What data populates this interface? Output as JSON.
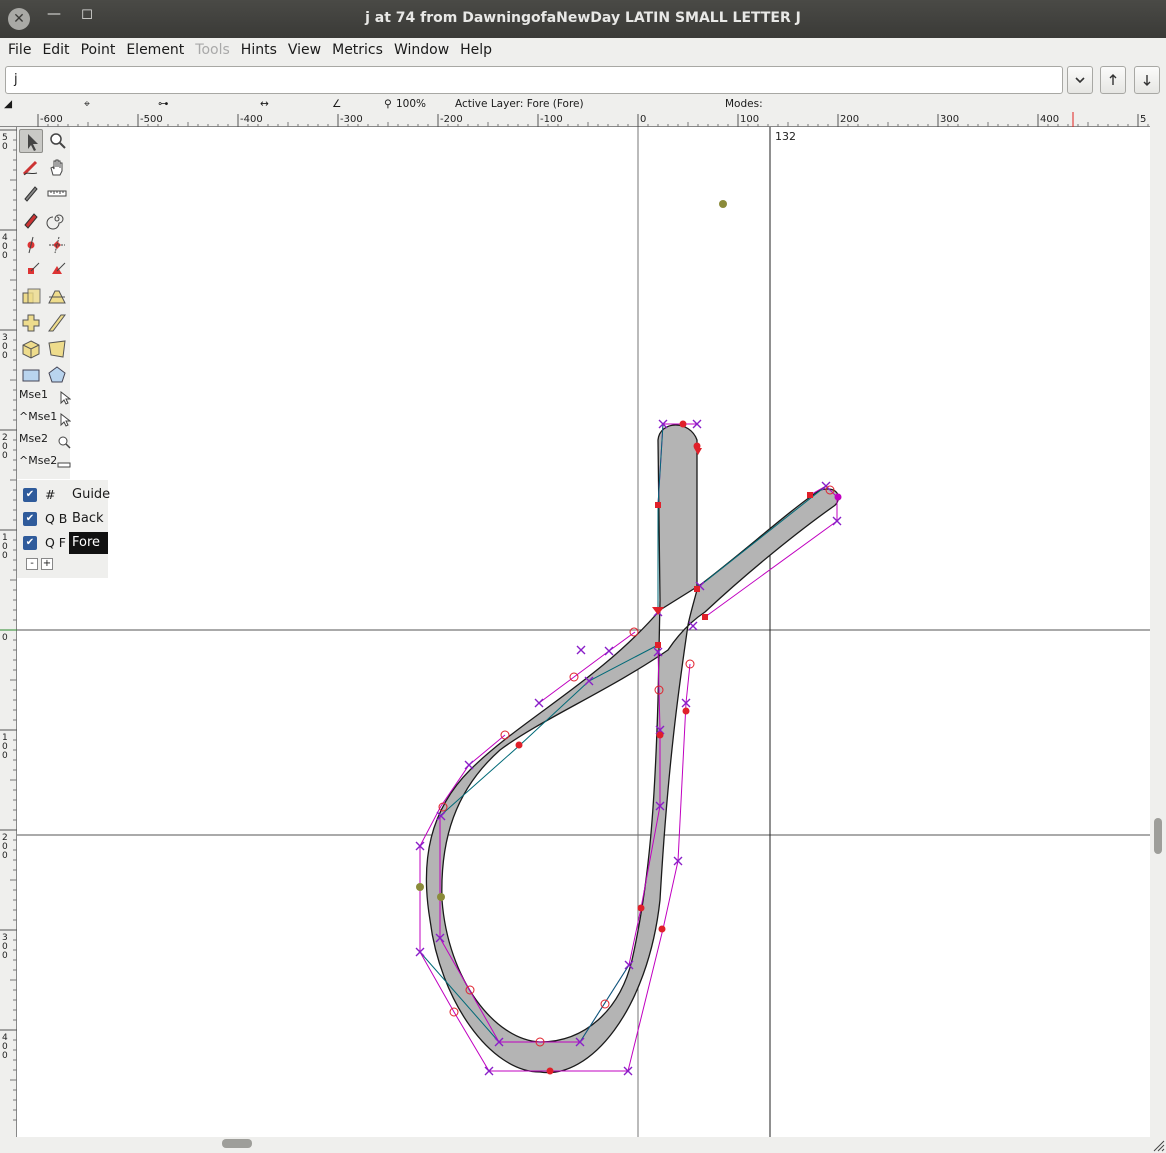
{
  "window": {
    "title": "j at 74 from DawningofaNewDay LATIN SMALL LETTER J",
    "close_glyph": "✕",
    "minimize_glyph": "—",
    "maximize_glyph": "☐"
  },
  "menu": [
    {
      "label": "File",
      "enabled": true
    },
    {
      "label": "Edit",
      "enabled": true
    },
    {
      "label": "Point",
      "enabled": true
    },
    {
      "label": "Element",
      "enabled": true
    },
    {
      "label": "Tools",
      "enabled": false
    },
    {
      "label": "Hints",
      "enabled": true
    },
    {
      "label": "View",
      "enabled": true
    },
    {
      "label": "Metrics",
      "enabled": true
    },
    {
      "label": "Window",
      "enabled": true
    },
    {
      "label": "Help",
      "enabled": true
    }
  ],
  "glyph_field": {
    "value": "j"
  },
  "info_bar": {
    "zoom": "100%",
    "active_layer": "Active Layer: Fore (Fore)",
    "modes": "Modes:"
  },
  "rulers": {
    "horizontal_ticks": [
      "-600",
      "-500",
      "-400",
      "-300",
      "-200",
      "-100",
      "0",
      "100",
      "200",
      "300",
      "400",
      "5"
    ],
    "vertical_ticks": [
      "5 0",
      "4 0 0",
      "3 0 0",
      "2 0 0",
      "1 0 0",
      "0",
      "1 0 0",
      "2 0 0",
      "3 0 0",
      "4 0 0"
    ]
  },
  "canvas": {
    "advance_width_label": "132"
  },
  "tools": {
    "icons": [
      "pointer-icon",
      "magnify-icon",
      "freehand-icon",
      "hand-icon",
      "knife-icon",
      "ruler-icon",
      "pen-icon",
      "spiral-icon",
      "curve-point-icon",
      "hv-curve-point-icon",
      "corner-point-icon",
      "tangent-point-icon",
      "scale-icon",
      "flip-icon",
      "rotate-icon",
      "skew-icon",
      "3d-rotate-icon",
      "perspective-icon",
      "rectangle-icon",
      "polygon-icon"
    ],
    "mouse_labels": [
      "Mse1",
      "^Mse1",
      "Mse2",
      "^Mse2"
    ]
  },
  "layers": [
    {
      "flags": "#",
      "name": "Guide",
      "visible": true,
      "active": false
    },
    {
      "flags": "Q B",
      "name": "Back",
      "visible": true,
      "active": false
    },
    {
      "flags": "Q F",
      "name": "Fore",
      "visible": true,
      "active": true
    }
  ],
  "layer_buttons": {
    "remove": "-",
    "add": "+"
  },
  "colors": {
    "glyph_fill": "#b4b4b4",
    "control_line": "#c000c0",
    "spline_line": "#006a78",
    "point_red": "#e0202a",
    "anchor_olive": "#8b8b3a"
  }
}
